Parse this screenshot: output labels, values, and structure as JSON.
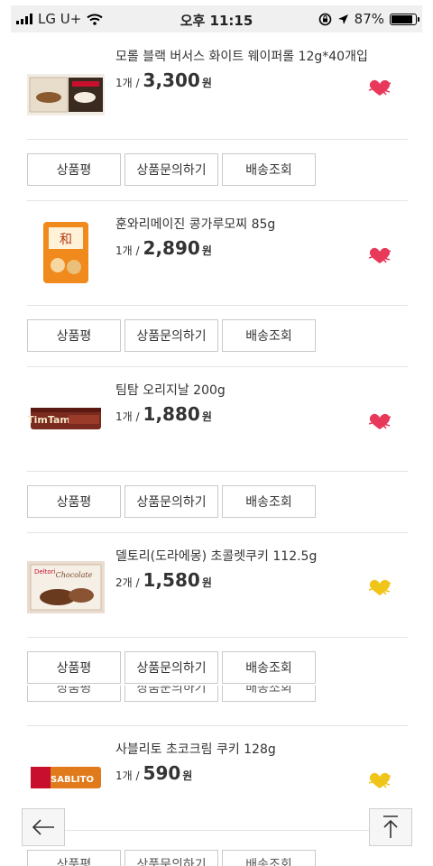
{
  "status_bar": {
    "carrier": "LG U+",
    "time": "오후 11:15",
    "battery": "87%",
    "battery_level": 0.87,
    "icons": [
      "signal-icon",
      "wifi-icon",
      "rotation-lock-icon",
      "location-arrow-icon",
      "battery-icon"
    ]
  },
  "actions": {
    "review": "상품평",
    "inquiry": "상품문의하기",
    "delivery": "배송조회"
  },
  "products": [
    {
      "name": "모롤 블랙 버서스 화이트 웨이퍼롤 12g*40개입",
      "qty": "1개 /",
      "price": "3,300",
      "won": "원",
      "heart_color": "#e8395a"
    },
    {
      "name": "훈와리메이진 콩가루모찌 85g",
      "qty": "1개 /",
      "price": "2,890",
      "won": "원",
      "heart_color": "#e8395a"
    },
    {
      "name": "팀탐 오리지날 200g",
      "qty": "1개 /",
      "price": "1,880",
      "won": "원",
      "heart_color": "#e8395a"
    },
    {
      "name": "델토리(도라에몽) 초콜렛쿠키 112.5g",
      "qty": "2개 /",
      "price": "1,580",
      "won": "원",
      "heart_color": "#f0c419"
    },
    {
      "name": "사블리토 초코크림 쿠키 128g",
      "qty": "1개 /",
      "price": "590",
      "won": "원",
      "heart_color": "#f0c419"
    }
  ],
  "nav": {
    "back_icon": "arrow-left-icon",
    "top_icon": "arrow-up-icon"
  }
}
